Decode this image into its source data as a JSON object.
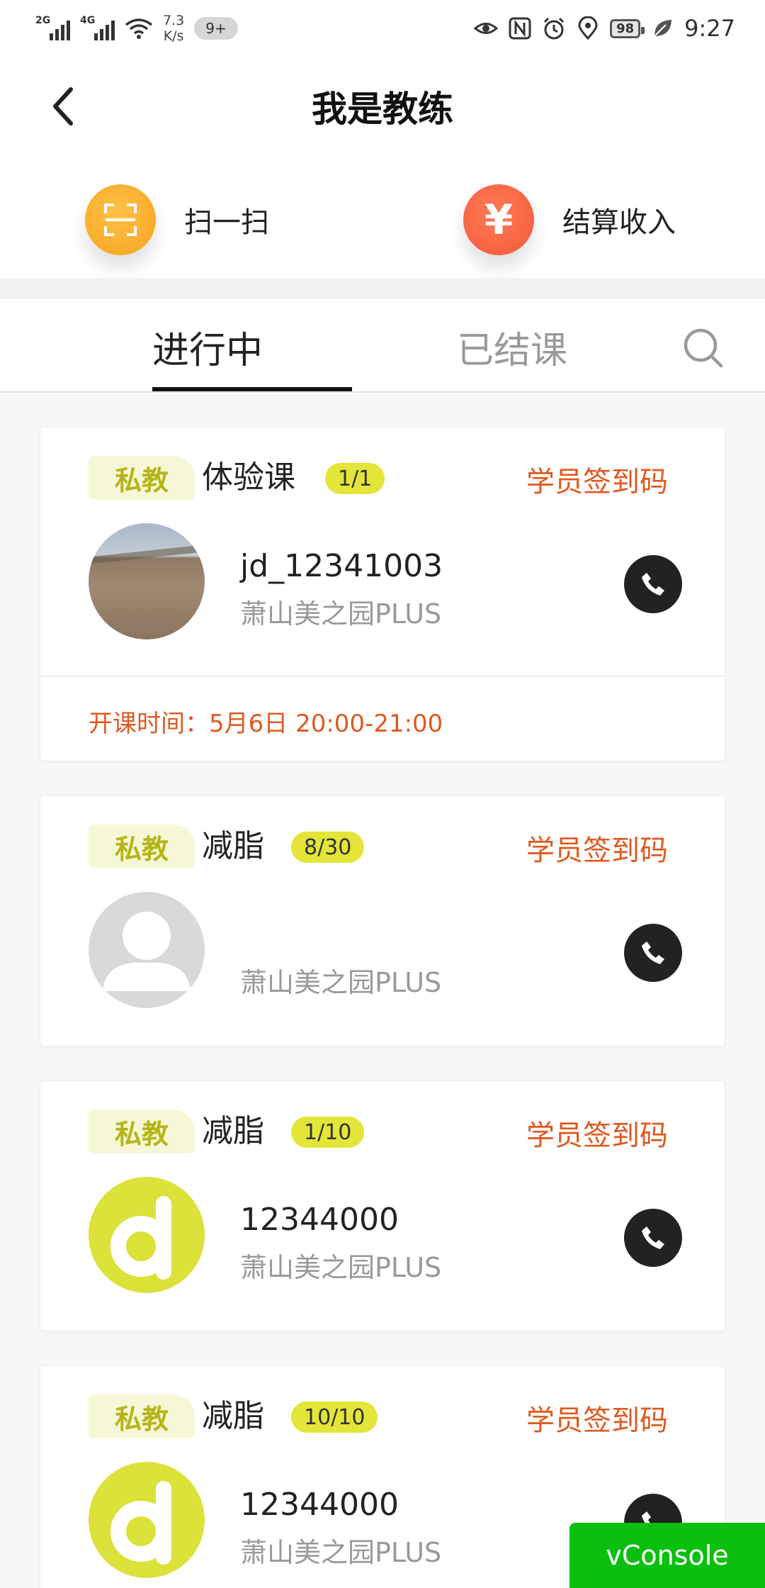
{
  "status_bar": {
    "signal1_label": "2G",
    "signal2_label": "4G",
    "speed_line1": "7.3",
    "speed_line2": "K/s",
    "notif_badge": "9+",
    "battery": "98",
    "time": "9:27"
  },
  "header": {
    "title": "我是教练"
  },
  "quick_actions": {
    "scan_label": "扫一扫",
    "settle_label": "结算收入",
    "settle_symbol": "¥"
  },
  "tabs": {
    "active": "进行中",
    "inactive": "已结课"
  },
  "common": {
    "checkin_label": "学员签到码",
    "tag_label": "私教"
  },
  "cards": [
    {
      "tag": "私教",
      "title": "体验课",
      "progress": "1/1",
      "checkin": "学员签到码",
      "user": "jd_12341003",
      "store": "萧山美之园PLUS",
      "avatar": "photo",
      "start_time": "开课时间：5月6日 20:00-21:00"
    },
    {
      "tag": "私教",
      "title": "减脂",
      "progress": "8/30",
      "checkin": "学员签到码",
      "user": "",
      "store": "萧山美之园PLUS",
      "avatar": "default"
    },
    {
      "tag": "私教",
      "title": "减脂",
      "progress": "1/10",
      "checkin": "学员签到码",
      "user": "12344000",
      "store": "萧山美之园PLUS",
      "avatar": "brand"
    },
    {
      "tag": "私教",
      "title": "减脂",
      "progress": "10/10",
      "checkin": "学员签到码",
      "user": "12344000",
      "store": "萧山美之园PLUS",
      "avatar": "brand"
    }
  ],
  "vconsole": {
    "label": "vConsole"
  },
  "colors": {
    "accent_orange": "#e0591f",
    "tag_bg": "#f6f7d6",
    "tag_text": "#b5b51a",
    "progress_bg": "#e3e638",
    "scan_icon": "#f7a21a",
    "settle_icon": "#f45a3a",
    "vconsole_bg": "#0bbf0f"
  }
}
